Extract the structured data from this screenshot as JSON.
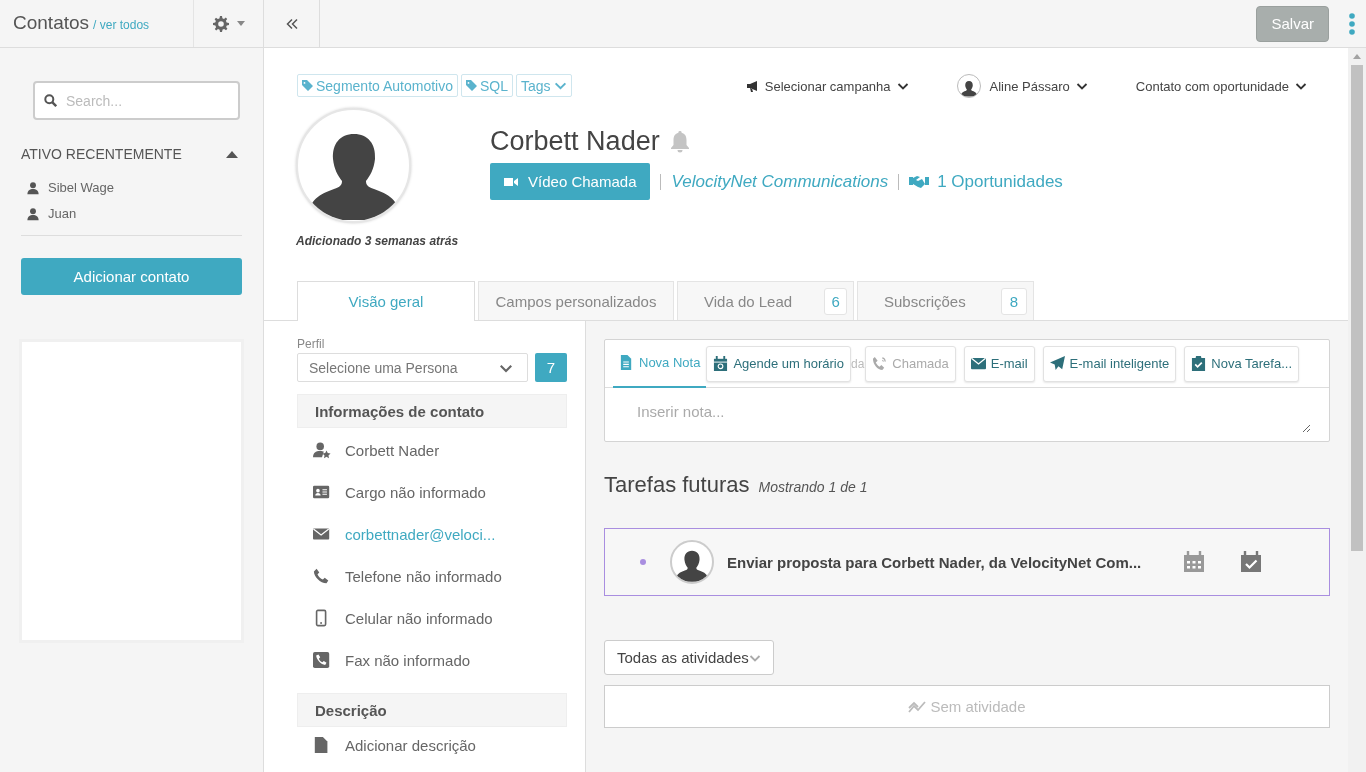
{
  "sidebar": {
    "title": "Contatos",
    "view_all_link": "/ ver todos",
    "search": {
      "placeholder": "Search..."
    },
    "recent": {
      "heading": "ATIVO RECENTEMENTE",
      "expanded": true,
      "items": [
        {
          "name": "Sibel Wage"
        },
        {
          "name": "Juan"
        }
      ]
    },
    "add_button": "Adicionar contato"
  },
  "toolbar": {
    "save_button": {
      "label": "Salvar",
      "disabled": true
    }
  },
  "contact": {
    "tags": [
      {
        "label": "Segmento Automotivo",
        "kind": "tag"
      },
      {
        "label": "SQL",
        "kind": "tag"
      },
      {
        "label": "Tags",
        "kind": "dropdown"
      }
    ],
    "selectors": [
      {
        "label": "Selecionar campanha",
        "kind": "campaign"
      },
      {
        "label": "Aline Pássaro",
        "kind": "owner"
      },
      {
        "label": "Contato com oportunidade",
        "kind": "status"
      }
    ],
    "name": "Corbett Nader",
    "video_button": "Vídeo Chamada",
    "company": "VelocityNet Communications",
    "opportunities": "1 Oportunidades",
    "added": "Adicionado 3 semanas atrás"
  },
  "tabs": [
    {
      "label": "Visão geral",
      "selected": true
    },
    {
      "label": "Campos personalizados",
      "selected": false
    },
    {
      "label": "Vida do Lead",
      "count": "6",
      "selected": false
    },
    {
      "label": "Subscrições",
      "count": "8",
      "selected": false
    }
  ],
  "profile": {
    "label": "Perfil",
    "persona_placeholder": "Selecione uma Persona",
    "persona_count": "7"
  },
  "sections": [
    {
      "title": "Informações de contato",
      "rows": [
        {
          "kind": "name",
          "text": "Corbett Nader"
        },
        {
          "kind": "job",
          "text": "Cargo não informado"
        },
        {
          "kind": "email",
          "text": "corbettnader@veloci..."
        },
        {
          "kind": "phone",
          "text": "Telefone não informado"
        },
        {
          "kind": "mobile",
          "text": "Celular não informado"
        },
        {
          "kind": "fax",
          "text": "Fax não informado"
        }
      ]
    },
    {
      "title": "Descrição",
      "rows": [
        {
          "kind": "description",
          "text": "Adicionar descrição"
        }
      ]
    }
  ],
  "composer": {
    "actions": [
      {
        "kind": "note",
        "label": "Nova Nota",
        "selected": true,
        "disabled": false
      },
      {
        "kind": "schedule",
        "label": "Agende um horário",
        "selected": false,
        "disabled": false
      },
      {
        "kind": "fragment",
        "label": "da"
      },
      {
        "kind": "call",
        "label": "Chamada",
        "selected": false,
        "disabled": true
      },
      {
        "kind": "email",
        "label": "E-mail",
        "selected": false,
        "disabled": false
      },
      {
        "kind": "smart-email",
        "label": "E-mail inteligente",
        "selected": false,
        "disabled": false
      },
      {
        "kind": "task",
        "label": "Nova Tarefa...",
        "selected": false,
        "disabled": false
      }
    ],
    "placeholder": "Inserir nota..."
  },
  "tasks": {
    "title": "Tarefas futuras",
    "count_text": "Mostrando 1 de 1",
    "items": [
      {
        "text": "Enviar proposta para Corbett Nader, da VelocityNet Com...",
        "color": "#a98ee0"
      }
    ]
  },
  "activities": {
    "filter": "Todas as atividades",
    "empty": "Sem atividade"
  }
}
